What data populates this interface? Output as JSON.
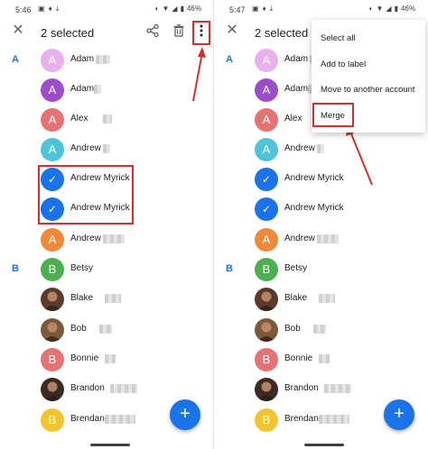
{
  "left": {
    "status": {
      "time": "5:46",
      "battery": "46%"
    },
    "title": "2 selected",
    "contacts": [
      {
        "section": "A",
        "initial": "A",
        "name": "Adam",
        "color": "#e8b0ec",
        "type": "letter"
      },
      {
        "section": "",
        "initial": "A",
        "name": "Adam",
        "color": "#9c4dcc",
        "type": "letter"
      },
      {
        "section": "",
        "initial": "A",
        "name": "Alex",
        "color": "#e57373",
        "type": "letter"
      },
      {
        "section": "",
        "initial": "A",
        "name": "Andrew",
        "color": "#4fc3d7",
        "type": "letter"
      },
      {
        "section": "",
        "initial": "✓",
        "name": "Andrew Myrick",
        "color": "#1a73e8",
        "type": "check"
      },
      {
        "section": "",
        "initial": "✓",
        "name": "Andrew Myrick",
        "color": "#1a73e8",
        "type": "check"
      },
      {
        "section": "",
        "initial": "A",
        "name": "Andrew",
        "color": "#f0883a",
        "type": "letter"
      },
      {
        "section": "B",
        "initial": "B",
        "name": "Betsy",
        "color": "#4caf50",
        "type": "letter"
      },
      {
        "section": "",
        "initial": "",
        "name": "Blake",
        "color": "#5b3a2e",
        "type": "photo"
      },
      {
        "section": "",
        "initial": "",
        "name": "Bob",
        "color": "#7a5a3a",
        "type": "photo"
      },
      {
        "section": "",
        "initial": "B",
        "name": "Bonnie",
        "color": "#e57373",
        "type": "letter"
      },
      {
        "section": "",
        "initial": "",
        "name": "Brandon",
        "color": "#3a2a22",
        "type": "photo"
      },
      {
        "section": "",
        "initial": "B",
        "name": "Brendan",
        "color": "#f4c430",
        "type": "letter"
      }
    ]
  },
  "right": {
    "status": {
      "time": "5:47",
      "battery": "46%"
    },
    "title": "2 selected",
    "menu": [
      "Select all",
      "Add to label",
      "Move to another account",
      "Merge"
    ],
    "contacts": [
      {
        "section": "A",
        "initial": "A",
        "name": "Adam",
        "color": "#e8b0ec",
        "type": "letter"
      },
      {
        "section": "",
        "initial": "A",
        "name": "Adam",
        "color": "#9c4dcc",
        "type": "letter"
      },
      {
        "section": "",
        "initial": "A",
        "name": "Alex",
        "color": "#e57373",
        "type": "letter"
      },
      {
        "section": "",
        "initial": "A",
        "name": "Andrew",
        "color": "#4fc3d7",
        "type": "letter"
      },
      {
        "section": "",
        "initial": "✓",
        "name": "Andrew Myrick",
        "color": "#1a73e8",
        "type": "check"
      },
      {
        "section": "",
        "initial": "✓",
        "name": "Andrew Myrick",
        "color": "#1a73e8",
        "type": "check"
      },
      {
        "section": "",
        "initial": "A",
        "name": "Andrew",
        "color": "#f0883a",
        "type": "letter"
      },
      {
        "section": "B",
        "initial": "B",
        "name": "Betsy",
        "color": "#4caf50",
        "type": "letter"
      },
      {
        "section": "",
        "initial": "",
        "name": "Blake",
        "color": "#5b3a2e",
        "type": "photo"
      },
      {
        "section": "",
        "initial": "",
        "name": "Bob",
        "color": "#7a5a3a",
        "type": "photo"
      },
      {
        "section": "",
        "initial": "B",
        "name": "Bonnie",
        "color": "#e57373",
        "type": "letter"
      },
      {
        "section": "",
        "initial": "",
        "name": "Brandon",
        "color": "#3a2a22",
        "type": "photo"
      },
      {
        "section": "",
        "initial": "B",
        "name": "Brendan",
        "color": "#f4c430",
        "type": "letter"
      }
    ]
  },
  "fab_label": "+",
  "colors": {
    "accent": "#1a73e8",
    "highlight": "#d32f2f"
  }
}
